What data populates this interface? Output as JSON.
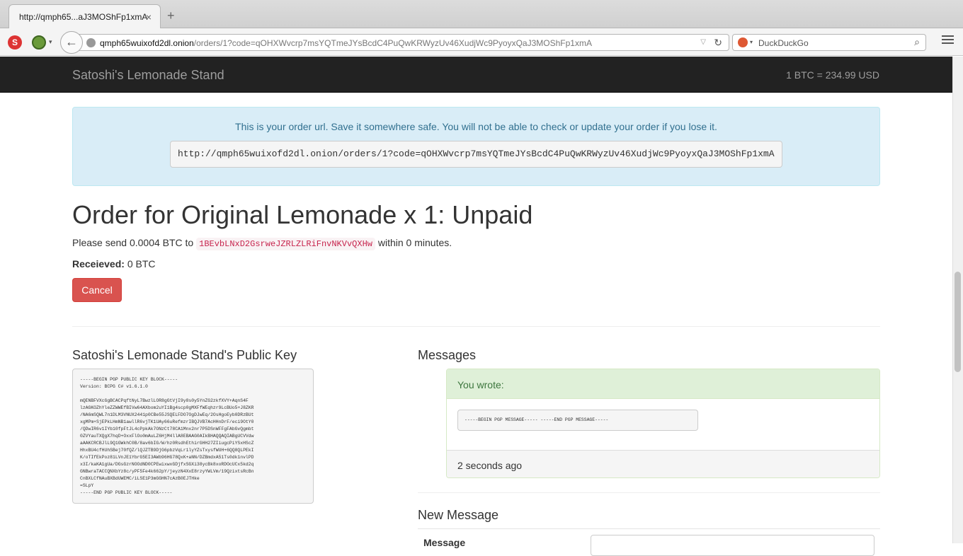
{
  "browser": {
    "tab_title": "http://qmph65...aJ3MOShFp1xmA",
    "tab_close": "×",
    "new_tab": "+",
    "url_host": "qmph65wuixofd2dl.onion",
    "url_path": "/orders/1?code=qOHXWvcrp7msYQTmeJYsBcdC4PuQwKRWyzUv46XudjWc9PyoyxQaJ3MOShFp1xmA",
    "search_engine": "DuckDuckGo",
    "icons": [
      "s-extension-icon",
      "onion-icon",
      "back-arrow-icon",
      "globe-icon",
      "reload-icon",
      "duckduckgo-icon",
      "search-icon",
      "hamburger-menu-icon"
    ]
  },
  "site": {
    "brand": "Satoshi's Lemonade Stand",
    "exchange_rate": "1 BTC = 234.99 USD"
  },
  "alert": {
    "text": "This is your order url. Save it somewhere safe. You will not be able to check or update your order if you lose it.",
    "order_url": "http://qmph65wuixofd2dl.onion/orders/1?code=qOHXWvcrp7msYQTmeJYsBcdC4PuQwKRWyzUv46XudjWc9PyoyxQaJ3MOShFp1xmA"
  },
  "order": {
    "title": "Order for Original Lemonade x 1: Unpaid",
    "send_prefix": "Please send 0.0004 BTC to",
    "address": "1BEvbLNxD2GsrweJZRLZLRiFnvNKVvQXHw",
    "send_suffix": "within 0 minutes.",
    "received_label": "Receieved:",
    "received_value": "0 BTC",
    "cancel_label": "Cancel"
  },
  "public_key": {
    "title": "Satoshi's Lemonade Stand's Public Key",
    "lines": [
      "-----BEGIN PGP PUBLIC KEY BLOCK-----",
      "Version: BCPG C# v1.6.1.0",
      "",
      "mQENBFVXcGgBCACPqftNyL7BwzlLOR8gGtVjI9y8s0y5YnZG2zkfXVY+AqnS4F",
      "lzAGKOZhYleZZWWEfBIVw64AXbom2uYI1Bg4scp0gMXFfWEqhzr9LcBUo5+J8ZKR",
      "/NA6mSQWL7n1DLM3VNUX2441p0CBe55JSQELFDO7OgDJwEq/2OsHgoEyb0DRzBUt",
      "xgMPm+SjEPkLHmNB1awllR6vjTK1UAy66uRefmzrIBQJVB7AcHHnDrF/eci9OtY0",
      "/QDwIR6v1IYb10fpFtJL4cPpkAk7ONzCt78CA1Mnx2nr7P5DSnWFFgFAbGvQgmbt",
      "0ZVYauTXQgX7hqD+OxxFlOo0mAuLZ6HjM4llA8EBAAG0AIkBHAQQAQIABgUCVVdw",
      "aAAKCRCBJlL9Q1GWkhC0B/8av6bIG/W/hz0RsdhEthirGHH27ZIiugcPiYSxHScZ",
      "HhxBU4cfHUhSBej70fQZ/lQJZTB9DjG6pbzVqLr1lyYZsTxysfWUH+6QQ8QLPEkI",
      "K/oTIfEkPoz81LVnJE1YbrG5EI3AWb96HG78QxK+aNN/DZBmdxA51Ts0dk1nvlPD",
      "x3I/kaKA1gUa/DGsGzrNOOdND0CPEwixwxGDjfxSGXi38ycBk8xoRDOcUCx5kd2q",
      "GNBwraTACCQNXbYz8c/yPF5Fe4k662pY/jeyzN4XxE8rzyYWLVm/19QzixtsRcBn",
      "CnBXLCfNAuBXBdUWEMC/iLSE1P3mGGHN7cAzB0EJTHke",
      "=SLpY",
      "-----END PGP PUBLIC KEY BLOCK-----"
    ]
  },
  "messages": {
    "title": "Messages",
    "items": [
      {
        "heading": "You wrote:",
        "body": "-----BEGIN PGP MESSAGE----- -----END PGP MESSAGE-----",
        "time": "2 seconds ago"
      }
    ]
  },
  "new_message": {
    "title": "New Message",
    "label": "Message"
  }
}
